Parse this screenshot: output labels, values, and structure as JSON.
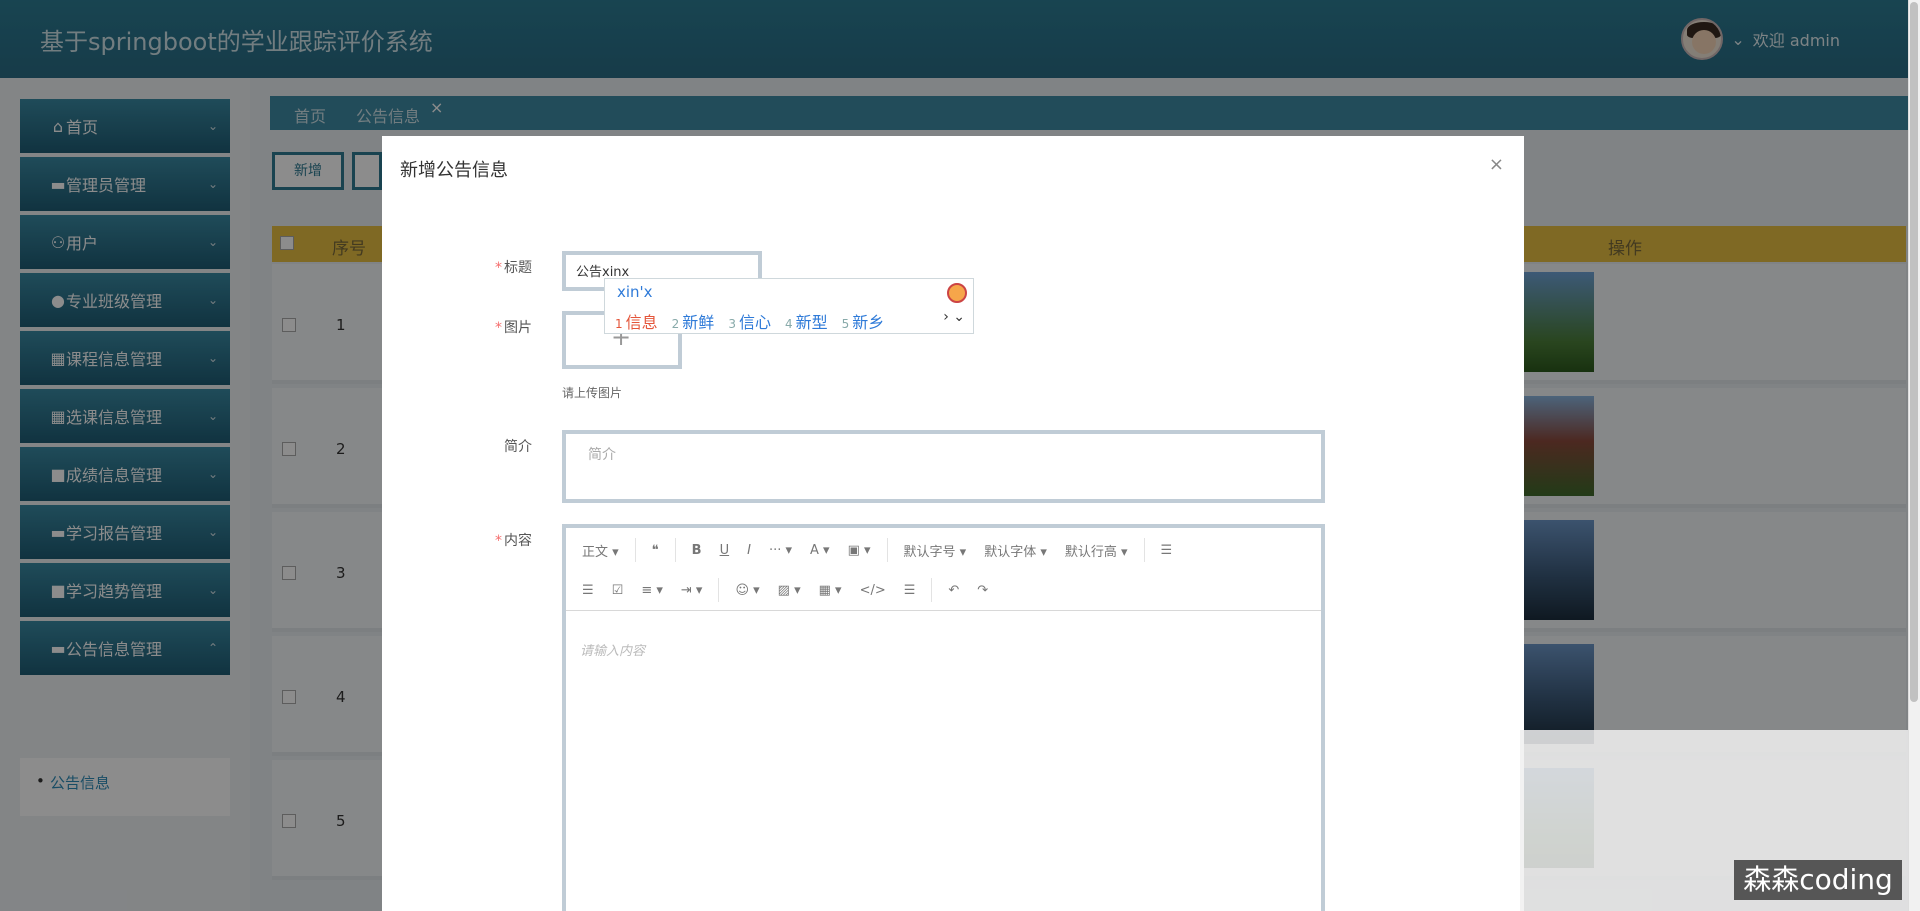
{
  "header": {
    "app_title": "基于springboot的学业跟踪评价系统",
    "welcome": "欢迎 admin"
  },
  "sidebar": {
    "items": [
      {
        "label": "首页",
        "icon": "⌂"
      },
      {
        "label": "管理员管理",
        "icon": "▬"
      },
      {
        "label": "用户",
        "icon": "⚇"
      },
      {
        "label": "专业班级管理",
        "icon": "●"
      },
      {
        "label": "课程信息管理",
        "icon": "▦"
      },
      {
        "label": "选课信息管理",
        "icon": "▦"
      },
      {
        "label": "成绩信息管理",
        "icon": "■"
      },
      {
        "label": "学习报告管理",
        "icon": "▬"
      },
      {
        "label": "学习趋势管理",
        "icon": "■"
      },
      {
        "label": "公告信息管理",
        "icon": "▬"
      }
    ],
    "submenu_item": "公告信息"
  },
  "tabs": {
    "home": "首页",
    "current": "公告信息",
    "close": "×"
  },
  "toolbar": {
    "add": "新增"
  },
  "table": {
    "col_index": "序号",
    "col_action": "操作",
    "rows": [
      "1",
      "2",
      "3",
      "4",
      "5"
    ]
  },
  "modal": {
    "title": "新增公告信息",
    "close": "×",
    "fields": {
      "title_label": "标题",
      "title_value": "公告xinx",
      "image_label": "图片",
      "image_hint": "请上传图片",
      "summary_label": "简介",
      "summary_placeholder": "简介",
      "content_label": "内容",
      "content_placeholder": "请输入内容"
    },
    "editor_toolbar": {
      "row1": [
        "正文 ▾",
        "❝",
        "B",
        "U",
        "I",
        "··· ▾",
        "A ▾",
        "▣ ▾",
        "默认字号 ▾",
        "默认字体 ▾",
        "默认行高 ▾",
        "☰"
      ],
      "row2": [
        "☰",
        "☑",
        "≡ ▾",
        "⇥ ▾",
        "☺ ▾",
        "▨ ▾",
        "▦ ▾",
        "</>",
        "☰",
        "↶",
        "↷"
      ]
    }
  },
  "ime": {
    "pinyin": "xin'x",
    "candidates": [
      {
        "num": "1",
        "text": "信息"
      },
      {
        "num": "2",
        "text": "新鲜"
      },
      {
        "num": "3",
        "text": "信心"
      },
      {
        "num": "4",
        "text": "新型"
      },
      {
        "num": "5",
        "text": "新乡"
      }
    ]
  },
  "watermark": "森森coding"
}
